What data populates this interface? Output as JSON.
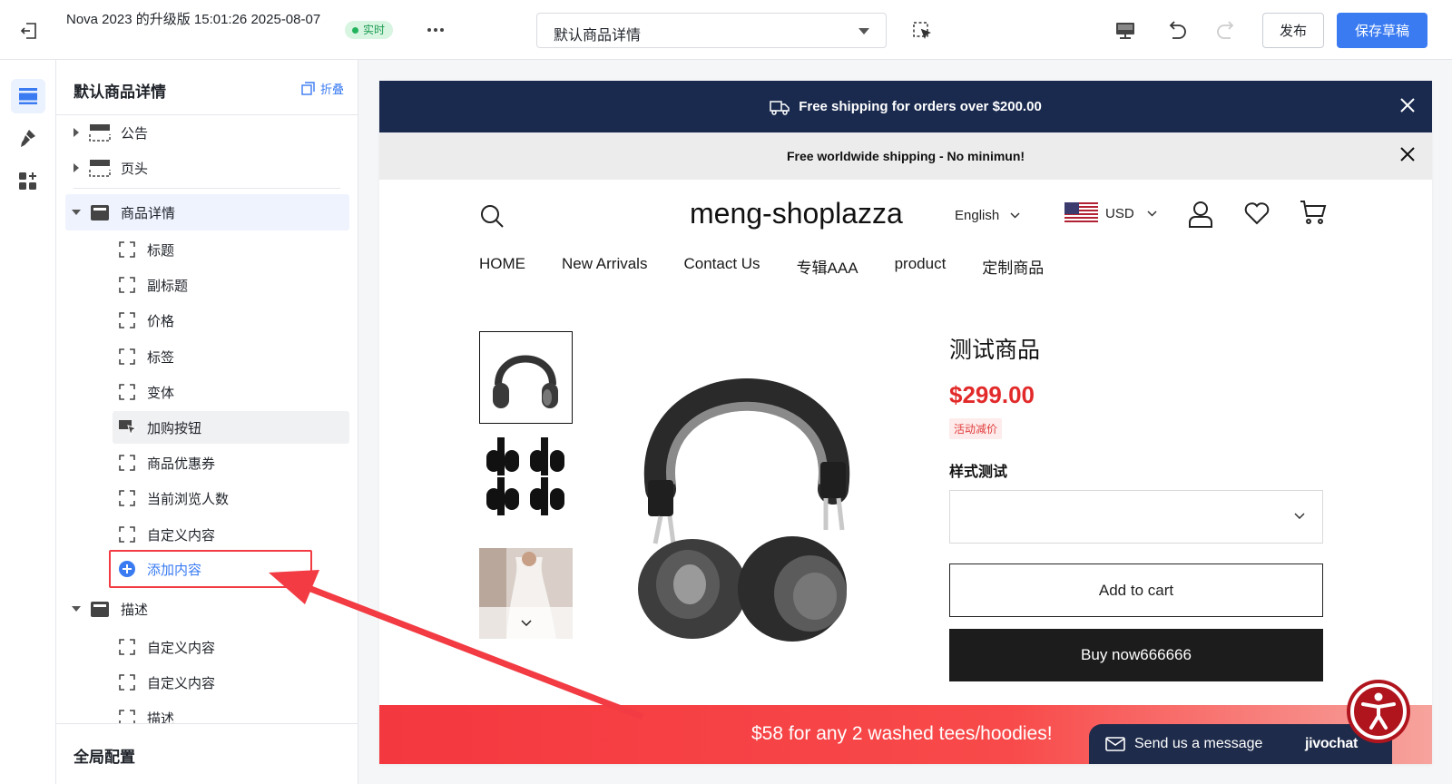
{
  "topbar": {
    "title": "Nova 2023 的升级版 15:01:26 2025-08-07",
    "live_badge": "实时",
    "template_select": "默认商品详情",
    "publish": "发布",
    "save_draft": "保存草稿"
  },
  "sidebar": {
    "title": "默认商品详情",
    "fold": "折叠",
    "sections": [
      {
        "label": "公告"
      },
      {
        "label": "页头"
      },
      {
        "label": "商品详情"
      },
      {
        "label": "描述"
      }
    ],
    "product_children": [
      "标题",
      "副标题",
      "价格",
      "标签",
      "变体",
      "加购按钮",
      "商品优惠券",
      "当前浏览人数",
      "自定义内容"
    ],
    "add_content": "添加内容",
    "desc_children": [
      "自定义内容",
      "自定义内容",
      "描述"
    ],
    "footer": "全局配置"
  },
  "preview": {
    "announcement_1": "Free shipping for orders over $200.00",
    "announcement_2": "Free worldwide shipping - No minimun!",
    "logo": "meng-shoplazza",
    "language": "English",
    "currency": "USD",
    "nav": [
      "HOME",
      "New Arrivals",
      "Contact Us",
      "专辑AAA",
      "product",
      "定制商品"
    ],
    "product": {
      "title": "测试商品",
      "price": "$299.00",
      "badge": "活动减价",
      "option_label": "样式测试",
      "add_to_cart": "Add to cart",
      "buy_now": "Buy now666666"
    },
    "promo": "$58 for any 2 washed tees/hoodies!",
    "chat": {
      "message": "Send us a message",
      "brand": "jivochat"
    }
  },
  "colors": {
    "accent": "#3a7bf2",
    "announcement_bg": "#1a2a4f",
    "price": "#e22a2a",
    "promo": "#f4383f",
    "highlight_border": "#f23b43"
  },
  "icons": [
    "exit-icon",
    "more-icon",
    "chevron-down-icon",
    "select-element-icon",
    "desktop-icon",
    "undo-icon",
    "redo-icon",
    "sections-icon",
    "brush-icon",
    "apps-icon",
    "collapse-icon",
    "search-icon",
    "user-icon",
    "heart-icon",
    "cart-icon",
    "close-icon",
    "truck-icon",
    "mail-icon",
    "accessibility-icon"
  ]
}
